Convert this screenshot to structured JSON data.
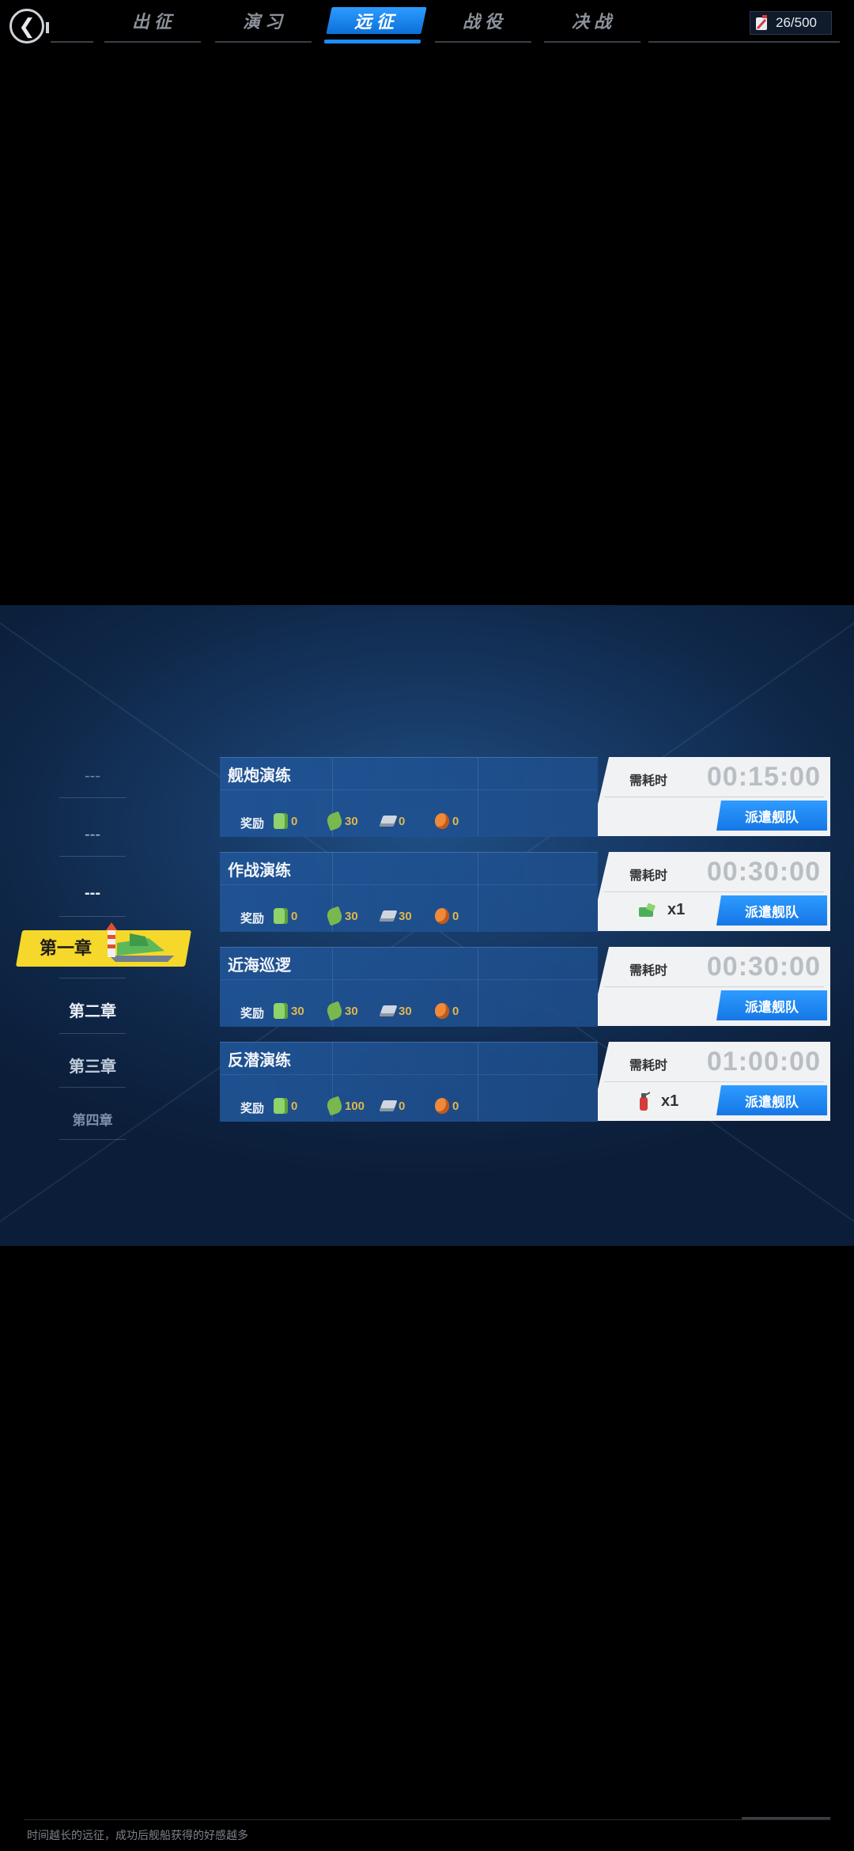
{
  "tabs": [
    {
      "label": "出征",
      "active": false
    },
    {
      "label": "演习",
      "active": false
    },
    {
      "label": "远征",
      "active": true
    },
    {
      "label": "战役",
      "active": false
    },
    {
      "label": "决战",
      "active": false
    }
  ],
  "fuel": {
    "value": "26/500",
    "icon": "fuel-can-icon"
  },
  "back_icon": "❮",
  "chapters": [
    {
      "label": "---"
    },
    {
      "label": "---"
    },
    {
      "label": "---"
    },
    {
      "label": "第一章",
      "selected": true
    },
    {
      "label": "第二章"
    },
    {
      "label": "第三章"
    },
    {
      "label": "第四章"
    }
  ],
  "missions": [
    {
      "name": "舰炮演练",
      "reward_label": "奖励",
      "rewards": [
        "0",
        "30",
        "0",
        "0"
      ],
      "need_label": "需耗时",
      "time": "00:15:00",
      "item": null,
      "dispatch": "派遣舰队"
    },
    {
      "name": "作战演练",
      "reward_label": "奖励",
      "rewards": [
        "0",
        "30",
        "30",
        "0"
      ],
      "need_label": "需耗时",
      "time": "00:30:00",
      "item": {
        "icon": "repair-bucket-icon",
        "qty": "x1"
      },
      "dispatch": "派遣舰队"
    },
    {
      "name": "近海巡逻",
      "reward_label": "奖励",
      "rewards": [
        "30",
        "30",
        "30",
        "0"
      ],
      "need_label": "需耗时",
      "time": "00:30:00",
      "item": null,
      "dispatch": "派遣舰队"
    },
    {
      "name": "反潜演练",
      "reward_label": "奖励",
      "rewards": [
        "0",
        "100",
        "0",
        "0"
      ],
      "need_label": "需耗时",
      "time": "01:00:00",
      "item": {
        "icon": "fire-extinguisher-icon",
        "qty": "x1"
      },
      "dispatch": "派遣舰队"
    }
  ],
  "resource_icons": [
    "fuel-icon",
    "ammo-icon",
    "steel-icon",
    "bauxite-icon"
  ],
  "footer_tip": "时间越长的远征，成功后舰船获得的好感越多",
  "colors": {
    "accent": "#1e8bff",
    "chapter_highlight": "#f5d829",
    "reward_value": "#e0b84a"
  }
}
